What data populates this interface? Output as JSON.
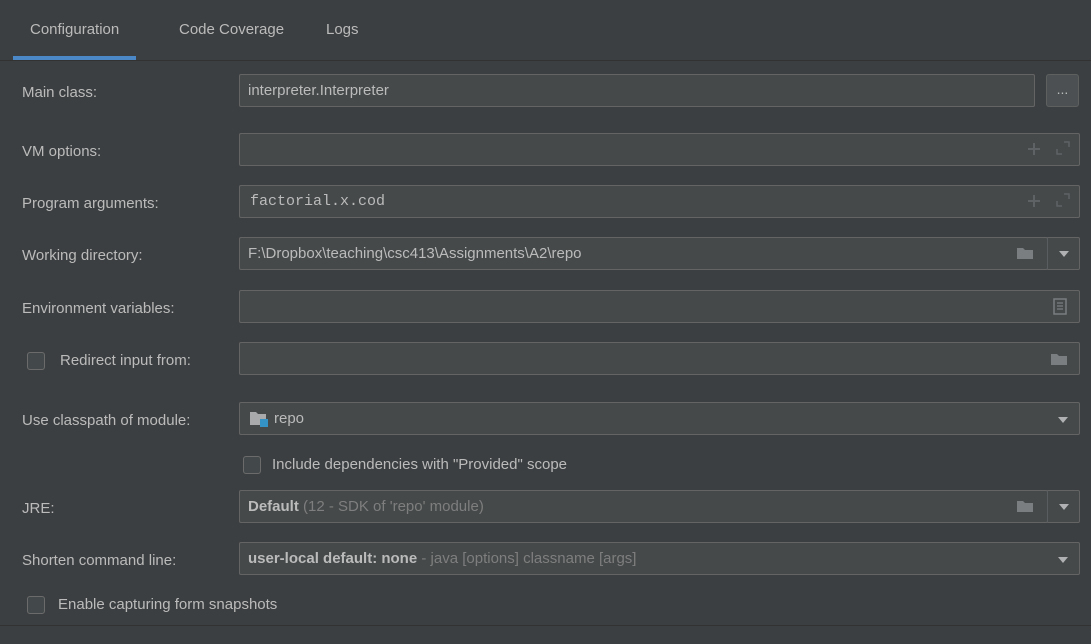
{
  "tabs": [
    "Configuration",
    "Code Coverage",
    "Logs"
  ],
  "main_class": {
    "label": "Main class:",
    "value": "interpreter.Interpreter",
    "browse_label": "..."
  },
  "vm_options": {
    "label": "VM options:",
    "value": ""
  },
  "program_arguments": {
    "label": "Program arguments:",
    "value": "factorial.x.cod"
  },
  "working_directory": {
    "label": "Working directory:",
    "value": "F:\\Dropbox\\teaching\\csc413\\Assignments\\A2\\repo"
  },
  "environment_variables": {
    "label": "Environment variables:",
    "value": ""
  },
  "redirect_input": {
    "label": "Redirect input from:",
    "checked": false,
    "value": ""
  },
  "classpath_module": {
    "label": "Use classpath of module:",
    "value": "repo"
  },
  "include_dependencies": {
    "label": "Include dependencies with \"Provided\" scope",
    "checked": false
  },
  "jre": {
    "label": "JRE:",
    "value": "Default",
    "hint": "(12 - SDK of 'repo' module)"
  },
  "shorten_command_line": {
    "label": "Shorten command line:",
    "value": "user-local default: none",
    "hint": "- java [options] classname [args]"
  },
  "enable_capturing": {
    "label": "Enable capturing form snapshots",
    "checked": false
  },
  "colors": {
    "background": "#3c3f41",
    "field": "#45494a",
    "border": "#646464",
    "text": "#bbbbbb",
    "dim": "#7e7e7e",
    "accent": "#4a88c7"
  },
  "icons": [
    "ellipsis-icon",
    "plus-icon",
    "expand-icon",
    "folder-icon",
    "chevron-down-icon",
    "document-icon",
    "module-folder-icon"
  ]
}
